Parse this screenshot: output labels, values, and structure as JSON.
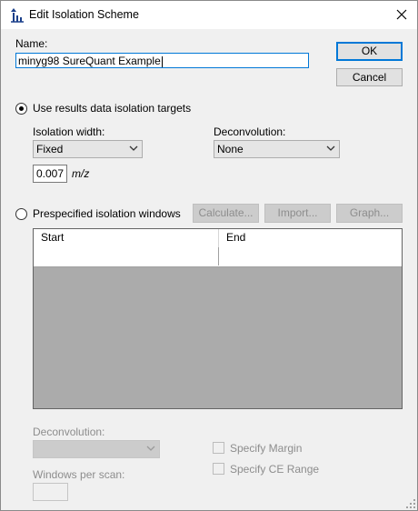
{
  "window": {
    "title": "Edit Isolation Scheme"
  },
  "form": {
    "name_label": "Name:",
    "name_value": "minyg98 SureQuant Example",
    "ok_label": "OK",
    "cancel_label": "Cancel",
    "use_results_label": "Use results data isolation targets",
    "use_results_selected": true,
    "isolation_width_label": "Isolation width:",
    "isolation_width_value": "Fixed",
    "deconvolution_label": "Deconvolution:",
    "deconvolution_value": "None",
    "width_value": "0.007",
    "width_unit": "m/z",
    "prespecified_label": "Prespecified isolation windows",
    "prespecified_selected": false,
    "calculate_label": "Calculate...",
    "import_label": "Import...",
    "graph_label": "Graph...",
    "grid_columns": [
      "Start",
      "End"
    ],
    "deconvolution2_label": "Deconvolution:",
    "deconvolution2_value": "",
    "specify_margin_label": "Specify Margin",
    "specify_ce_label": "Specify CE Range",
    "windows_per_scan_label": "Windows per scan:",
    "windows_per_scan_value": ""
  },
  "icons": {
    "app": "isolation-scheme-icon",
    "close": "close-icon",
    "dropdown": "chevron-down-icon",
    "resize": "resize-grip-icon"
  },
  "colors": {
    "focus_border": "#0078d7",
    "dialog_bg": "#f0f0f0",
    "grid_bg": "#ababab",
    "disabled_text": "#8d8d8d"
  }
}
